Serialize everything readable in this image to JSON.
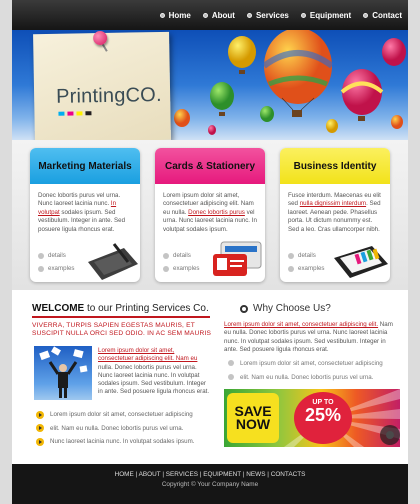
{
  "nav": {
    "items": [
      {
        "label": "Home"
      },
      {
        "label": "About"
      },
      {
        "label": "Services"
      },
      {
        "label": "Equipment"
      },
      {
        "label": "Contact"
      }
    ]
  },
  "header": {
    "logo_text": "PrintingCO.",
    "logo_dot_colors": [
      "#00aeef",
      "#ec008c",
      "#fff200",
      "#231f20"
    ]
  },
  "boxes": [
    {
      "title": "Marketing Materials",
      "color": "#1a9fe0",
      "text_before_link": "Donec lobortis purus vel urna. Nunc laoreet lacinia nunc. ",
      "link": "In volutpat",
      "text_after_link": " sodales ipsum. Sed vestibulum. Integer in ante. Sed posuere ligula rhoncus erat.",
      "link_details": "details",
      "link_examples": "examples",
      "icon": "graphics-tablet-icon"
    },
    {
      "title": "Cards & Stationery",
      "color": "#e6197d",
      "text_before_link": "Lorem ipsum dolor sit amet, consectetuer adipiscing elit. Nam eu nulla. ",
      "link": "Donec lobortis purus",
      "text_after_link": " vel urna. Nunc laoreet lacinia nunc. In volutpat sodales ipsum.",
      "link_details": "details",
      "link_examples": "examples",
      "icon": "id-badge-icon"
    },
    {
      "title": "Business Identity",
      "color": "#f2e21a",
      "text_before_link": "Fusce interdum. Maecenas eu elit sed ",
      "link": "nulla dignissim interdum",
      "text_after_link": ". Sed laoreet. Aenean pede. Phasellus porta. Ut dictum nonummy est. Sed a leo. Cras ullamcorper nibh.",
      "link_details": "details",
      "link_examples": "examples",
      "icon": "color-swatch-icon"
    }
  ],
  "welcome": {
    "title_bold": "WELCOME",
    "title_rest": " to our Printing Services Co.",
    "tagline": "VIVERRA, TURPIS SAPIEN EGESTAS MAURIS, ET SUSCIPIT NULLA ORCI SED ODIO. IN AC SEM MAURIS",
    "text_link": "Lorem ipsum dolor sit amet, consectetuer adipiscing elit. Nam eu",
    "text_rest": " nulla. Donec lobortis purus vel urna. Nunc laoreet lacinia nunc. In volutpat sodales ipsum. Sed vestibulum. Integer in ante. Sed posuere ligula rhoncus erat.",
    "bullets": [
      "Lorem ipsum dolor sit amet, consectetuer adipiscing",
      "elit. Nam eu nulla. Donec lobortis purus vel urna.",
      "Nunc laoreet lacinia nunc. In volutpat sodales ipsum."
    ]
  },
  "why": {
    "title": "Why Choose Us?",
    "text_link": "Lorem ipsum dolor sit amet, consectetuer adipiscing elit.",
    "text_rest": " Nam eu nulla. Donec lobortis purus vel urna. Nunc laoreet lacinia nunc. In volutpat sodales ipsum. Sed vestibulum. Integer in ante. Sed posuere ligula rhoncus erat.",
    "bullets": [
      "Lorem ipsum dolor sit amet, consectetuer adipiscing",
      "elit. Nam eu nulla. Donec lobortis purus vel urna."
    ]
  },
  "sale": {
    "save": "SAVE NOW",
    "up_to": "UP TO",
    "percent": "25%"
  },
  "footer": {
    "links": [
      "HOME",
      "ABOUT",
      "SERVICES",
      "EQUIPMENT",
      "NEWS",
      "CONTACTS"
    ],
    "separator": " | ",
    "copyright": "Copyright © Your Company Name"
  }
}
